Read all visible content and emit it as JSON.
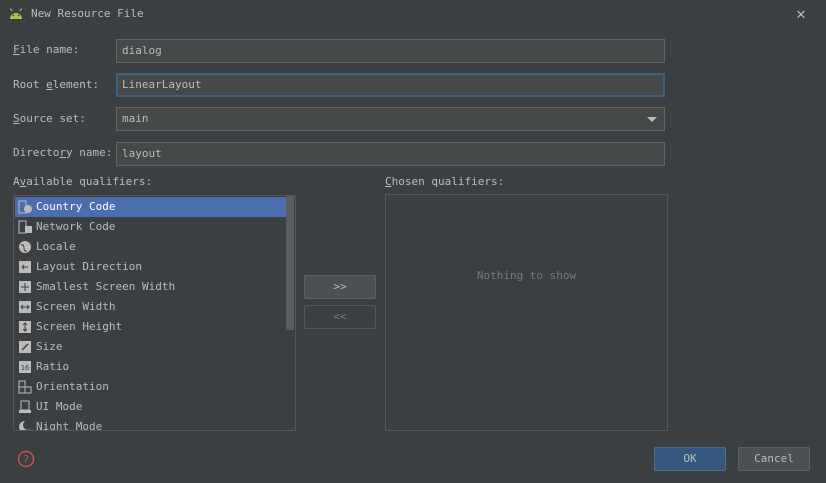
{
  "window": {
    "title": "New Resource File"
  },
  "form": {
    "file_name": {
      "label_pre": "",
      "mnemonic": "F",
      "label_post": "ile name:",
      "value": "dialog"
    },
    "root_element": {
      "label_pre": "Root ",
      "mnemonic": "e",
      "label_post": "lement:",
      "value": "LinearLayout"
    },
    "source_set": {
      "label_pre": "",
      "mnemonic": "S",
      "label_post": "ource set:",
      "value": "main"
    },
    "directory_name": {
      "label_pre": "Directo",
      "mnemonic": "r",
      "label_post": "y name:",
      "value": "layout"
    }
  },
  "available": {
    "label_pre": "A",
    "mnemonic": "v",
    "label_post": "ailable qualifiers:",
    "items": [
      {
        "label": "Country Code",
        "icon": "country-code-icon",
        "selected": true
      },
      {
        "label": "Network Code",
        "icon": "network-code-icon",
        "selected": false
      },
      {
        "label": "Locale",
        "icon": "globe-icon",
        "selected": false
      },
      {
        "label": "Layout Direction",
        "icon": "layout-direction-icon",
        "selected": false
      },
      {
        "label": "Smallest Screen Width",
        "icon": "smallest-width-icon",
        "selected": false
      },
      {
        "label": "Screen Width",
        "icon": "screen-width-icon",
        "selected": false
      },
      {
        "label": "Screen Height",
        "icon": "screen-height-icon",
        "selected": false
      },
      {
        "label": "Size",
        "icon": "size-icon",
        "selected": false
      },
      {
        "label": "Ratio",
        "icon": "ratio-icon",
        "selected": false
      },
      {
        "label": "Orientation",
        "icon": "orientation-icon",
        "selected": false
      },
      {
        "label": "UI Mode",
        "icon": "ui-mode-icon",
        "selected": false
      },
      {
        "label": "Night Mode",
        "icon": "night-mode-icon",
        "selected": false
      }
    ]
  },
  "chosen": {
    "label_pre": "",
    "mnemonic": "C",
    "label_post": "hosen qualifiers:",
    "empty_text": "Nothing to show"
  },
  "buttons": {
    "add": ">>",
    "remove": "<<",
    "ok": "OK",
    "cancel": "Cancel"
  },
  "colors": {
    "background": "#3c3f41",
    "selection": "#4b6eaf",
    "android_green": "#a4c639",
    "help_red": "#c75450"
  }
}
